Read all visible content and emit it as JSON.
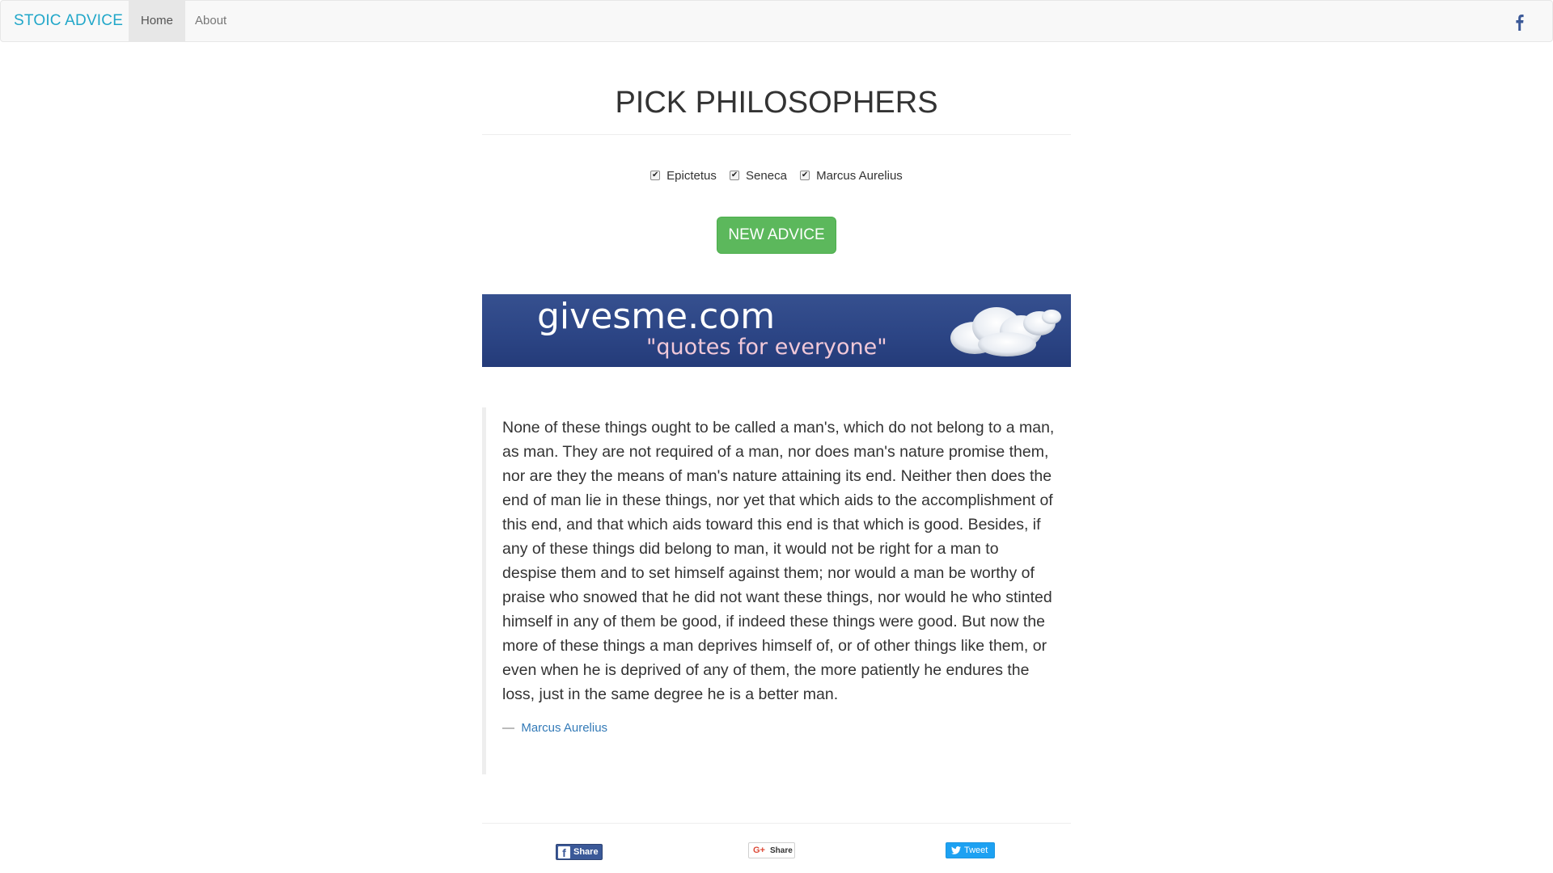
{
  "navbar": {
    "brand": "STOIC ADVICE",
    "links": [
      "Home",
      "About"
    ],
    "facebook_icon": "f"
  },
  "header": {
    "title": "PICK PHILOSOPHERS"
  },
  "philosophers": [
    {
      "label": "Epictetus",
      "checked": true
    },
    {
      "label": "Seneca",
      "checked": true
    },
    {
      "label": "Marcus Aurelius",
      "checked": true
    }
  ],
  "button": {
    "label": "NEW ADVICE",
    "color": "#5cb85c"
  },
  "banner": {
    "site": "givesme.com",
    "tagline": "\"quotes for everyone\""
  },
  "quote": {
    "text": "None of these things ought to be called a man's, which do not belong to a man, as man. They are not required of a man, nor does man's nature promise them, nor are they the means of man's nature attaining its end. Neither then does the end of man lie in these things, nor yet that which aids to the accomplishment of this end, and that which aids toward this end is that which is good. Besides, if any of these things did belong to man, it would not be right for a man to despise them and to set himself against them; nor would a man be worthy of praise who snowed that he did not want these things, nor would he who stinted himself in any of them be good, if indeed these things were good. But now the more of these things a man deprives himself of, or of other things like them, or even when he is deprived of any of them, the more patiently he endures the loss, just in the same degree he is a better man.",
    "dash": "—",
    "author": "Marcus Aurelius"
  },
  "share": {
    "facebook": "Share",
    "google": "Share",
    "google_glyph": "G+",
    "twitter": "Tweet"
  },
  "colors": {
    "brand": "#21a7c9",
    "link": "#337ab7",
    "facebook": "#3b5998",
    "twitter": "#1da1f2",
    "banner_bg": "#2c4585"
  }
}
